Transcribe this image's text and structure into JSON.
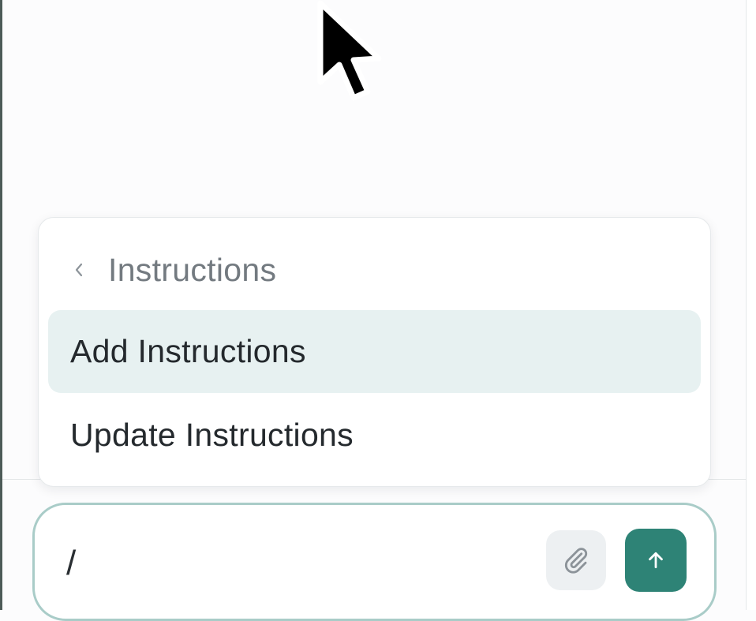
{
  "popup": {
    "back_icon": "chevron-left-icon",
    "title": "Instructions",
    "items": [
      {
        "label": "Add Instructions",
        "active": true
      },
      {
        "label": "Update Instructions",
        "active": false
      }
    ]
  },
  "composer": {
    "value": "/",
    "attach_icon": "paperclip-icon",
    "send_icon": "arrow-up-icon"
  },
  "colors": {
    "accent": "#2e8376",
    "highlight": "#e7f1f1",
    "composer_border": "#a9ccc8"
  }
}
